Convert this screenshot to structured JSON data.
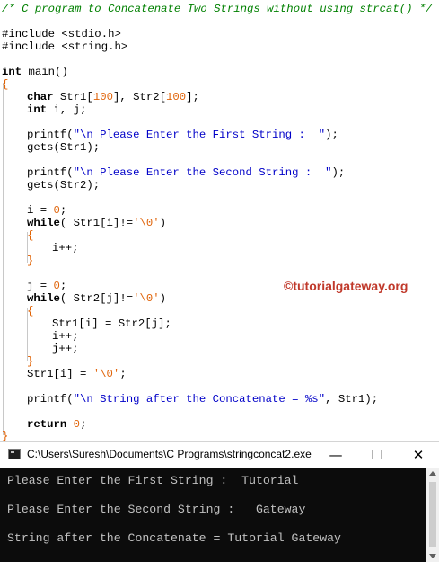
{
  "editor": {
    "comment": "/* C program to Concatenate Two Strings without using strcat() */",
    "include1": "#include <stdio.h>",
    "include2": "#include <string.h>",
    "main_kw": "int",
    "main_rest": " main()",
    "open_brace": "{",
    "decl_type": "char",
    "decl_a": " Str1[",
    "decl_n1": "100",
    "decl_b": "], Str2[",
    "decl_n2": "100",
    "decl_c": "];",
    "decl2_type": "int",
    "decl2_rest": " i, j;",
    "p1_a": "printf(",
    "p1_str": "\"\\n Please Enter the First String :  \"",
    "p1_b": ");",
    "gets1": "gets(Str1);",
    "p2_a": "printf(",
    "p2_str": "\"\\n Please Enter the Second String :  \"",
    "p2_b": ");",
    "gets2": "gets(Str2);",
    "i_init_a": "i = ",
    "i_init_n": "0",
    "i_init_b": ";",
    "while1_kw": "while",
    "while1_a": "( Str1[i]!=",
    "while1_ch": "'\\0'",
    "while1_b": ")",
    "w1_open": "{",
    "w1_body": "i++;",
    "w1_close": "}",
    "j_init_a": "j = ",
    "j_init_n": "0",
    "j_init_b": ";",
    "while2_kw": "while",
    "while2_a": "( Str2[j]!=",
    "while2_ch": "'\\0'",
    "while2_b": ")",
    "w2_open": "{",
    "w2_body1": "Str1[i] = Str2[j];",
    "w2_body2": "i++;",
    "w2_body3": "j++;",
    "w2_close": "}",
    "term_a": "Str1[i] = ",
    "term_ch": "'\\0'",
    "term_b": ";",
    "p3_a": "printf(",
    "p3_str": "\"\\n String after the Concatenate = %s\"",
    "p3_b": ", Str1);",
    "ret_kw": "return",
    "ret_sp": " ",
    "ret_n": "0",
    "ret_b": ";",
    "close_brace": "}"
  },
  "watermark": "©tutorialgateway.org",
  "console": {
    "title": "C:\\Users\\Suresh\\Documents\\C Programs\\stringconcat2.exe",
    "minimize_glyph": "—",
    "maximize_glyph": "☐",
    "close_glyph": "✕",
    "output": [
      "Please Enter the First String :  Tutorial",
      "Please Enter the Second String :   Gateway",
      "String after the Concatenate = Tutorial Gateway"
    ]
  },
  "colors": {
    "comment": "#008000",
    "string": "#0000c8",
    "number": "#e0640a",
    "watermark": "#c0392b",
    "console_bg": "#0c0c0c",
    "console_fg": "#c0c0c0"
  },
  "icons": [
    "console-app-icon",
    "minimize-icon",
    "maximize-icon",
    "close-icon"
  ]
}
